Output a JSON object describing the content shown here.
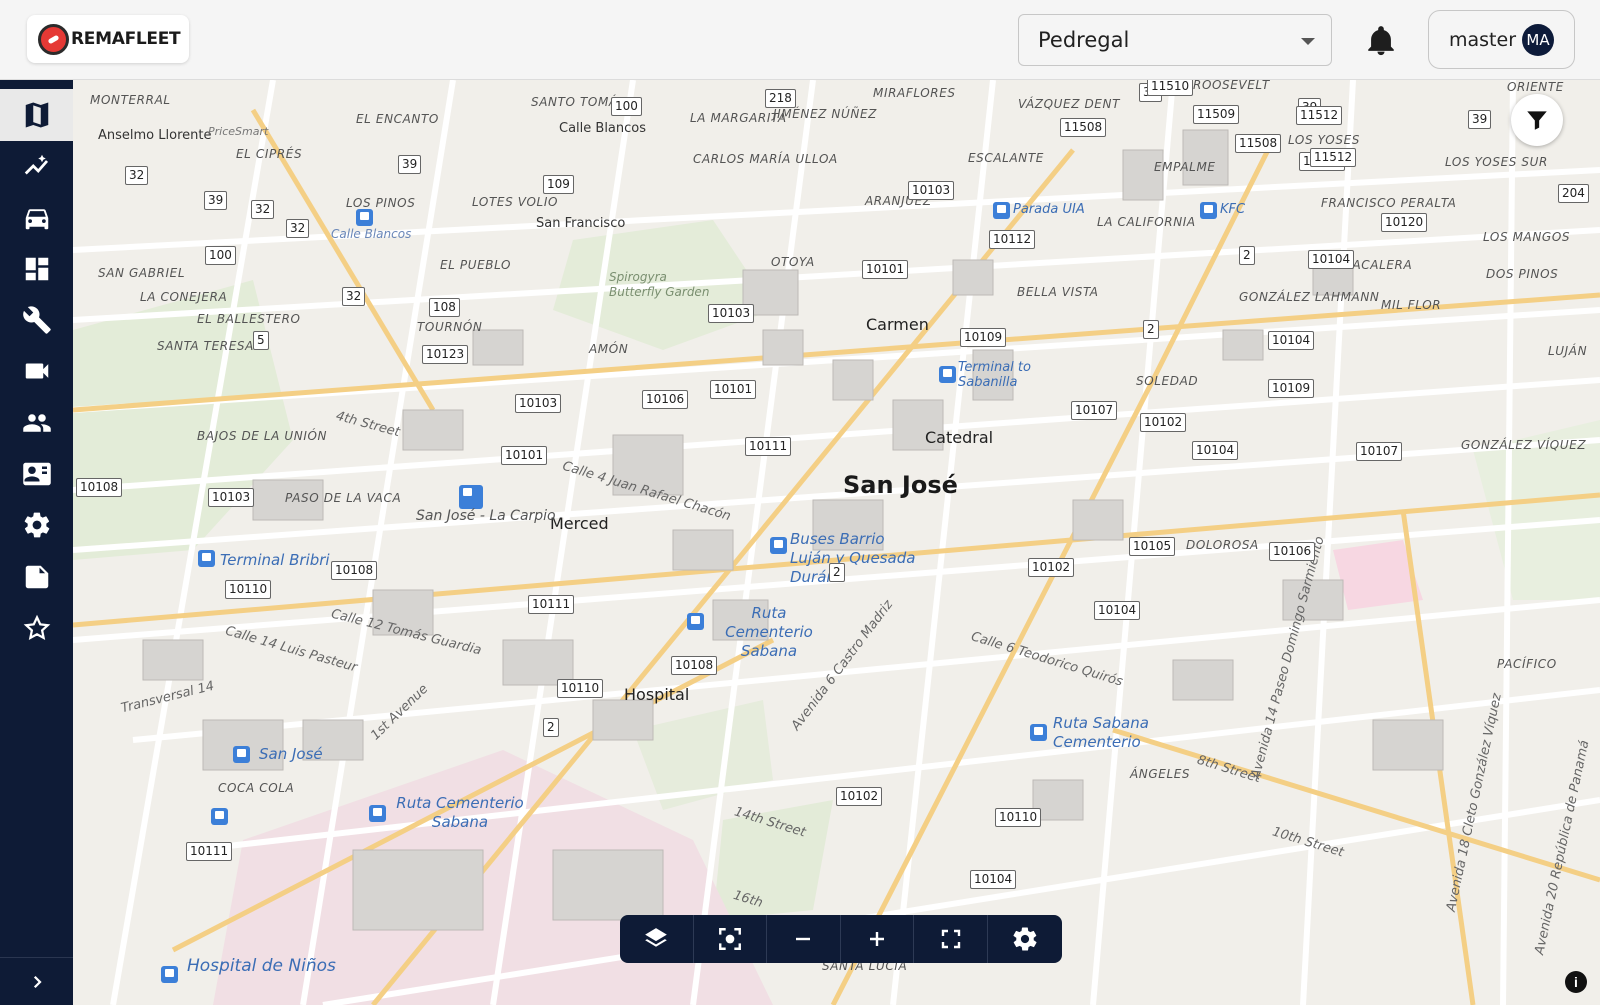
{
  "header": {
    "brand": "REMAFLEET",
    "fleet_selector": {
      "value": "Pedregal"
    },
    "user": {
      "name": "master",
      "initials": "MA"
    }
  },
  "sidebar": {
    "items": [
      {
        "icon": "map-icon",
        "active": true
      },
      {
        "icon": "analytics-icon",
        "active": false
      },
      {
        "icon": "car-icon",
        "active": false
      },
      {
        "icon": "dashboard-icon",
        "active": false
      },
      {
        "icon": "wrench-icon",
        "active": false
      },
      {
        "icon": "video-camera-icon",
        "active": false
      },
      {
        "icon": "people-icon",
        "active": false
      },
      {
        "icon": "contact-card-icon",
        "active": false
      },
      {
        "icon": "settings-icon",
        "active": false
      },
      {
        "icon": "report-icon",
        "active": false
      },
      {
        "icon": "star-icon",
        "active": false
      }
    ],
    "expand_icon": "chevron-right-icon"
  },
  "map": {
    "city_label": "San José",
    "neighborhoods": [
      "Carmen",
      "Catedral",
      "Merced",
      "Hospital"
    ],
    "districts": [
      "MONTERRAL",
      "EL ENCANTO",
      "SANTO TOMÁS",
      "LA MARGARITA",
      "JIMÉNEZ NÚÑEZ",
      "MIRAFLORES",
      "VÁZQUEZ DENT",
      "ROOSEVELT",
      "ORIENTE",
      "EL CIPRÉS",
      "CARLOS MARÍA ULLOA",
      "ESCALANTE",
      "LOS YOSES",
      "LOS YOSES SUR",
      "LOS PINOS",
      "LOTES VOLIO",
      "ARANJUEZ",
      "EMPALME",
      "LA CALIFORNIA",
      "FRANCISCO PERALTA",
      "SAN GABRIEL",
      "LA CONEJERA",
      "EL PUEBLO",
      "OTOYA",
      "BELLA VISTA",
      "TABACALERA",
      "LOS MANGOS",
      "DOS PINOS",
      "EL BALLESTERO",
      "TOURNÓN",
      "GONZÁLEZ LAHMANN",
      "MIL FLOR",
      "SANTA TERESA",
      "AMÓN",
      "SOLEDAD",
      "LUJÁN",
      "BAJOS DE LA UNIÓN",
      "GONZÁLEZ VÍQUEZ",
      "PASO DE LA VACA",
      "DOLOROSA",
      "PACÍFICO",
      "COCA COLA",
      "ÁNGELES",
      "SANTA LUCÍA"
    ],
    "places": [
      "Anselmo Llorente",
      "PriceSmart",
      "Calle Blancos",
      "San Francisco",
      "Spirogyra Butterfly Garden"
    ],
    "transit": [
      "Parada UIA",
      "KFC",
      "Calle Blancos",
      "Terminal to Sabanilla",
      "San José - La Carpio",
      "Terminal Bribri",
      "Buses Barrio Luján y Quesada Durán",
      "Ruta Cementerio Sabana",
      "Ruta Sabana Cementerio",
      "San José",
      "Hospital de Niños"
    ],
    "streets": [
      "4th Street",
      "Calle 4 Juan Rafael Chacón",
      "Calle 12 Tomás Guardia",
      "Calle 14 Luis Pasteur",
      "Transversal 14",
      "1st Avenue",
      "Avenida 6 Castro Madriz",
      "Calle 6 Teodorico Quirós",
      "Avenida 14 Paseo Domingo Sarmiento",
      "8th Street",
      "10th Street",
      "Avenida 18 Cleto González Víquez",
      "Avenida 20 República de Panamá",
      "14th Street",
      "16th"
    ],
    "route_shields": [
      "10101",
      "10103",
      "10106",
      "10111",
      "10102",
      "10104",
      "10105",
      "10107",
      "10108",
      "10109",
      "10110",
      "10112",
      "10120",
      "10123",
      "100",
      "108",
      "109",
      "218",
      "39",
      "32",
      "5",
      "2",
      "11508",
      "11509",
      "11510",
      "11512",
      "204"
    ]
  },
  "map_controls": {
    "toolbar": [
      "layers-icon",
      "focus-icon",
      "zoom-out-icon",
      "zoom-in-icon",
      "fullscreen-icon",
      "settings-icon"
    ],
    "filter": "filter-icon",
    "info": "i"
  }
}
